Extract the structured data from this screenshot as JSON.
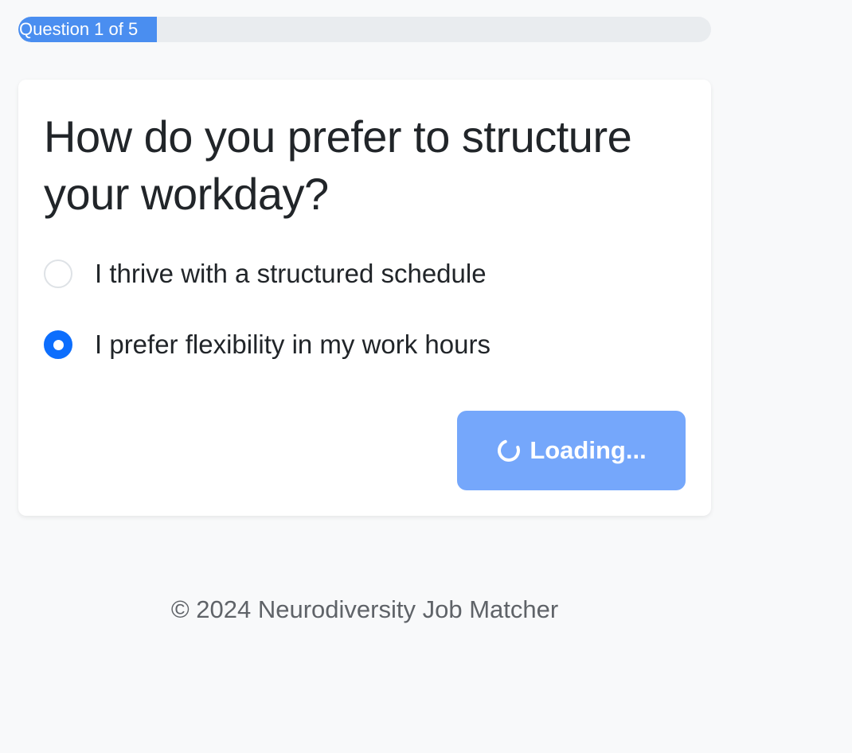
{
  "progress": {
    "label": "Question 1 of 5",
    "fraction": 0.2,
    "fill_color": "#4a8ef0",
    "track_color": "#e9ecef"
  },
  "question": {
    "title": "How do you prefer to structure your workday?",
    "options": [
      {
        "label": "I thrive with a structured schedule",
        "selected": false
      },
      {
        "label": "I prefer flexibility in my work hours",
        "selected": true
      }
    ]
  },
  "actions": {
    "loading_label": "Loading...",
    "spinner_icon": "spinner-icon",
    "button_color": "#75a7fb"
  },
  "footer": {
    "text": "© 2024 Neurodiversity Job Matcher"
  },
  "colors": {
    "accent": "#0d6efd",
    "background": "#f8f9fa"
  }
}
